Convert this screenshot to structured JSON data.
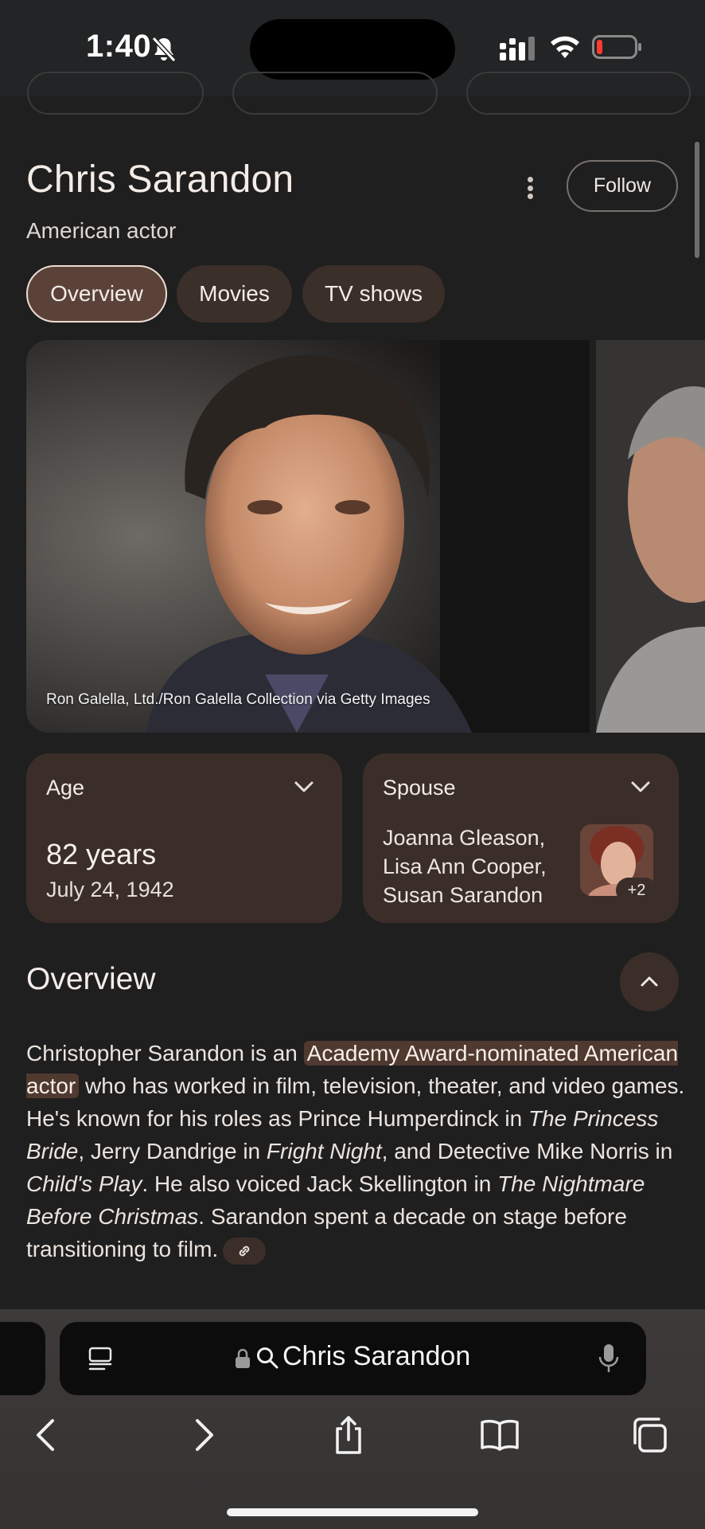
{
  "status_bar": {
    "time": "1:40",
    "icons": [
      "bell-slash-icon",
      "cellular-signal-icon",
      "wifi-icon",
      "battery-low-icon"
    ]
  },
  "entity": {
    "name": "Chris Sarandon",
    "description": "American actor",
    "follow_label": "Follow",
    "tabs": [
      {
        "label": "Overview",
        "active": true
      },
      {
        "label": "Movies",
        "active": false
      },
      {
        "label": "TV shows",
        "active": false
      }
    ],
    "image_credit": "Ron Galella, Ltd./Ron Galella Collection via Getty Images"
  },
  "facts": {
    "age": {
      "label": "Age",
      "value": "82 years",
      "detail": "July 24, 1942"
    },
    "spouse": {
      "label": "Spouse",
      "names": [
        "Joanna Gleason,",
        "Lisa Ann Cooper,",
        "Susan Sarandon"
      ],
      "extra_count": "+2"
    }
  },
  "overview": {
    "heading": "Overview",
    "parts": [
      {
        "text": "Christopher Sarandon is an ",
        "style": "plain"
      },
      {
        "text": "Academy Award-nominated American actor",
        "style": "highlight"
      },
      {
        "text": " who has worked in film, television, theater, and video games. He's known for his roles as Prince Humperdinck in ",
        "style": "plain"
      },
      {
        "text": "The Princess Bride",
        "style": "italic"
      },
      {
        "text": ", Jerry Dandrige in ",
        "style": "plain"
      },
      {
        "text": "Fright Night",
        "style": "italic"
      },
      {
        "text": ", and Detective Mike Norris in ",
        "style": "plain"
      },
      {
        "text": "Child's Play",
        "style": "italic"
      },
      {
        "text": ". He also voiced Jack Skellington in ",
        "style": "plain"
      },
      {
        "text": "The Nightmare Before Christmas",
        "style": "italic"
      },
      {
        "text": ". Sarandon spent a decade on stage before transitioning to film.",
        "style": "plain"
      }
    ]
  },
  "browser": {
    "query": "Chris Sarandon",
    "nav_icons": [
      "back-icon",
      "forward-icon",
      "share-icon",
      "bookmarks-icon",
      "tabs-icon"
    ]
  },
  "colors": {
    "background": "#1f1f1f",
    "chip": "#3b2f2a",
    "chip_active": "#5a4238",
    "highlight": "#50392f"
  }
}
